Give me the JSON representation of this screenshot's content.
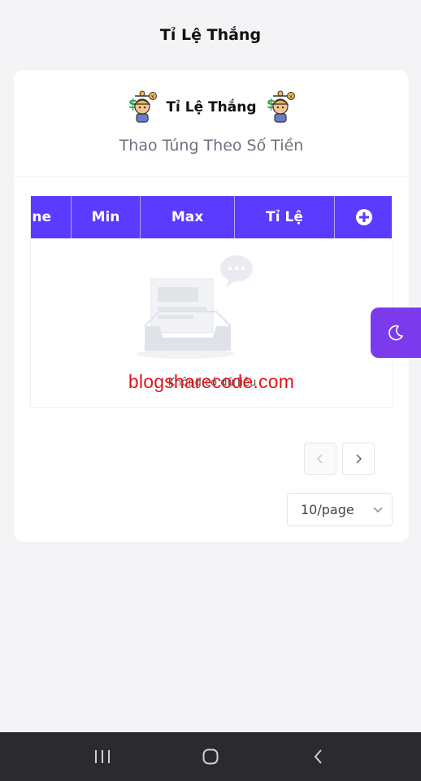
{
  "header": {
    "title": "Tỉ Lệ Thắng"
  },
  "card": {
    "brand_text": "Tỉ Lệ Thắng",
    "subtitle": "Thao Túng Theo Số Tiền"
  },
  "table": {
    "columns": [
      "ne",
      "Min",
      "Max",
      "Tỉ Lệ"
    ],
    "add_icon": "plus-circle-icon",
    "header_color": "#5b3bff",
    "empty_text": "Không có dữ liệu"
  },
  "watermark": "blogsharecode.com",
  "pagination": {
    "prev_icon": "chevron-left-icon",
    "next_icon": "chevron-right-icon",
    "page_size": "10/page"
  },
  "theme_toggle": {
    "icon": "moon-icon",
    "color": "#7c3aed"
  },
  "system_nav": {
    "icons": [
      "recent-apps-icon",
      "home-icon",
      "back-icon"
    ]
  }
}
